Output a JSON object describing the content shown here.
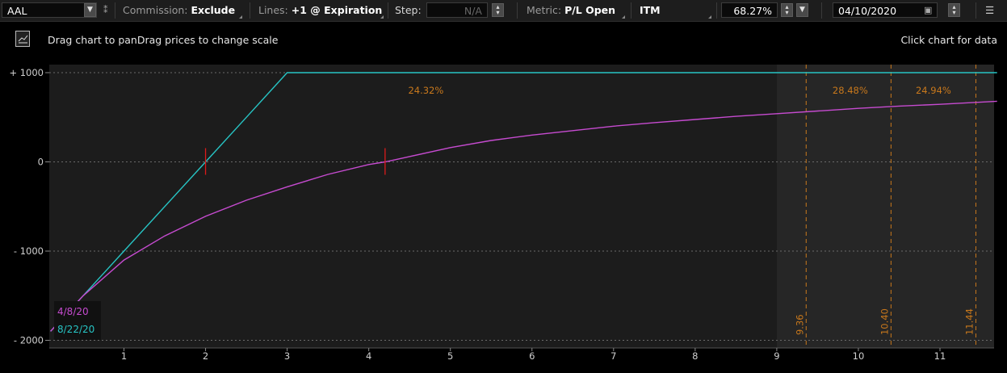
{
  "toolbar": {
    "symbol": "AAL",
    "commission_label": "Commission:",
    "commission_value": "Exclude",
    "lines_label": "Lines:",
    "lines_value": "+1 @ Expiration",
    "step_label": "Step:",
    "step_value": "N/A",
    "metric_label": "Metric:",
    "metric_value": "P/L Open",
    "itm_label": "ITM",
    "percent_value": "68.27%",
    "date_value": "04/10/2020",
    "icons": [
      "dropdown-arrow-icon",
      "link-icon",
      "stepper-icon",
      "calendar-icon",
      "menu-icon"
    ]
  },
  "info": {
    "chart_icon": "chart-thumbnail-icon",
    "drag_text": "Drag chart to panDrag prices to change scale",
    "click_text": "Click chart for data"
  },
  "colors": {
    "background": "#000000",
    "plot_bg": "#1c1c1c",
    "shaded_bg": "#262626",
    "expiration_series": "#27c4c4",
    "current_series": "#c64bd0",
    "annotation": "#c8781c",
    "breakeven_marker": "#dd1a1a"
  },
  "chart_data": {
    "type": "line",
    "title": "",
    "xlabel": "",
    "ylabel": "",
    "xlim": [
      0.1,
      11.7
    ],
    "ylim": [
      -2000,
      1000
    ],
    "yticks": [
      1000,
      0,
      -1000,
      -2000
    ],
    "ytick_labels": [
      "+ 1000",
      "0",
      "- 1000",
      "- 2000"
    ],
    "xticks": [
      1,
      2,
      3,
      4,
      5,
      6,
      7,
      8,
      9,
      10,
      11
    ],
    "xtick_labels": [
      "1",
      "2",
      "3",
      "4",
      "5",
      "6",
      "7",
      "8",
      "9",
      "10",
      "11"
    ],
    "grid": "dotted at y ticks",
    "series": [
      {
        "name": "8/22/20",
        "color": "#27c4c4",
        "x": [
          0.1,
          1.0,
          2.0,
          2.5,
          3.0,
          4.0,
          5.0,
          6.0,
          7.0,
          8.0,
          9.0,
          10.0,
          11.0,
          11.7
        ],
        "y": [
          -1900,
          -1000,
          0,
          500,
          1000,
          1000,
          1000,
          1000,
          1000,
          1000,
          1000,
          1000,
          1000,
          1000
        ]
      },
      {
        "name": "4/8/20",
        "color": "#c64bd0",
        "x": [
          0.1,
          0.5,
          1.0,
          1.5,
          2.0,
          2.5,
          3.0,
          3.5,
          4.0,
          4.2,
          4.5,
          5.0,
          5.5,
          6.0,
          6.5,
          7.0,
          7.5,
          8.0,
          8.5,
          9.0,
          9.5,
          10.0,
          10.5,
          11.0,
          11.7
        ],
        "y": [
          -1900,
          -1500,
          -1100,
          -830,
          -610,
          -430,
          -280,
          -140,
          -30,
          0,
          60,
          160,
          240,
          300,
          350,
          400,
          440,
          475,
          510,
          540,
          570,
          600,
          625,
          645,
          680
        ]
      }
    ],
    "breakeven_markers": [
      {
        "x": 2.0,
        "y": 0,
        "series": "8/22/20"
      },
      {
        "x": 4.2,
        "y": 0,
        "series": "4/8/20"
      }
    ],
    "probability_lines": [
      {
        "x": 9.36,
        "label": "9.36"
      },
      {
        "x": 10.4,
        "label": "10.40"
      },
      {
        "x": 11.44,
        "label": "11.44"
      }
    ],
    "probability_zone_labels": [
      {
        "x": 4.7,
        "y": 800,
        "label": "24.32%"
      },
      {
        "x": 9.9,
        "y": 800,
        "label": "28.48%"
      },
      {
        "x": 10.92,
        "y": 800,
        "label": "24.94%"
      }
    ],
    "shaded_region_x": [
      9.0,
      11.7
    ],
    "legend": {
      "position": "bottom-left",
      "entries": [
        "4/8/20",
        "8/22/20"
      ]
    }
  }
}
